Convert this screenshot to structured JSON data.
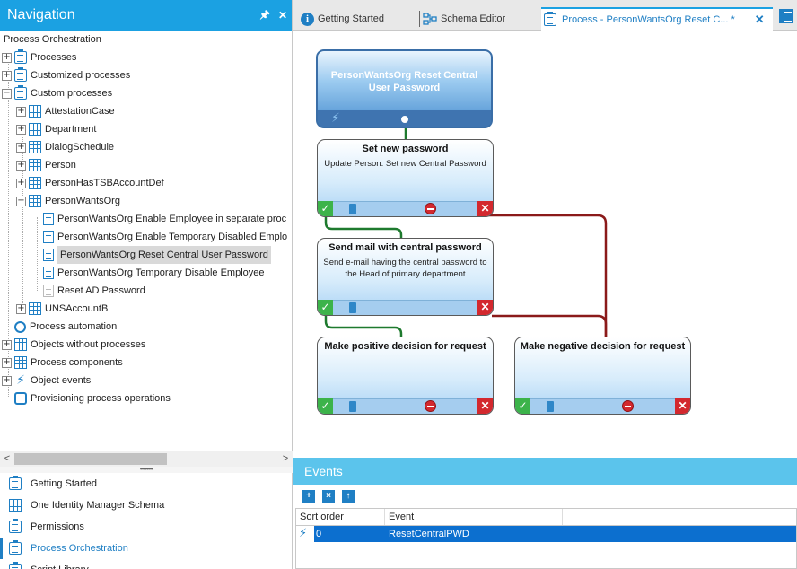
{
  "navigation": {
    "title": "Navigation",
    "pin_icon": "pin-icon",
    "close_icon": "close-icon",
    "tree": {
      "root": "Process Orchestration",
      "items": [
        {
          "label": "Processes",
          "icon": "clipboard-icon",
          "level": 0,
          "expander": "+"
        },
        {
          "label": "Customized processes",
          "icon": "clipboard-check-icon",
          "level": 0,
          "expander": "+"
        },
        {
          "label": "Custom processes",
          "icon": "user-process-icon",
          "level": 0,
          "expander": "−"
        },
        {
          "label": "AttestationCase",
          "icon": "table-icon",
          "level": 1,
          "expander": "+"
        },
        {
          "label": "Department",
          "icon": "table-icon",
          "level": 1,
          "expander": "+"
        },
        {
          "label": "DialogSchedule",
          "icon": "table-icon",
          "level": 1,
          "expander": "+"
        },
        {
          "label": "Person",
          "icon": "table-icon",
          "level": 1,
          "expander": "+"
        },
        {
          "label": "PersonHasTSBAccountDef",
          "icon": "table-icon",
          "level": 1,
          "expander": "+"
        },
        {
          "label": "PersonWantsOrg",
          "icon": "table-icon",
          "level": 1,
          "expander": "−"
        },
        {
          "label": "PersonWantsOrg Enable Employee in separate proc",
          "icon": "document-icon",
          "level": 2
        },
        {
          "label": "PersonWantsOrg Enable Temporary Disabled Emplo",
          "icon": "document-icon",
          "level": 2
        },
        {
          "label": "PersonWantsOrg Reset Central User Password",
          "icon": "document-icon",
          "level": 2,
          "selected": true
        },
        {
          "label": "PersonWantsOrg Temporary Disable Employee",
          "icon": "document-icon",
          "level": 2
        },
        {
          "label": "Reset AD Password",
          "icon": "document-disabled-icon",
          "level": 2
        },
        {
          "label": "UNSAccountB",
          "icon": "table-icon",
          "level": 1,
          "expander": "+"
        },
        {
          "label": "Process automation",
          "icon": "gear-icon",
          "level": 0
        },
        {
          "label": "Objects without processes",
          "icon": "table-icon",
          "level": 0,
          "expander": "+"
        },
        {
          "label": "Process components",
          "icon": "components-icon",
          "level": 0,
          "expander": "+"
        },
        {
          "label": "Object events",
          "icon": "lightning-icon",
          "level": 0,
          "expander": "+"
        },
        {
          "label": "Provisioning process operations",
          "icon": "sync-icon",
          "level": 0
        }
      ]
    },
    "bottom_items": [
      {
        "label": "Getting Started",
        "icon": "clipboard-check-icon"
      },
      {
        "label": "One Identity Manager Schema",
        "icon": "schema-icon"
      },
      {
        "label": "Permissions",
        "icon": "permissions-icon"
      },
      {
        "label": "Process Orchestration",
        "icon": "clipboard-icon",
        "active": true
      },
      {
        "label": "Script Library",
        "icon": "script-icon"
      }
    ],
    "scroll_left": "<",
    "scroll_right": ">",
    "splitter_grip": "••••••••"
  },
  "tabs": [
    {
      "label": "Getting Started",
      "icon": "info-icon"
    },
    {
      "label": "Schema Editor",
      "icon": "schema-icon"
    },
    {
      "label": "Process - PersonWantsOrg Reset C... *",
      "icon": "clipboard-icon",
      "active": true
    }
  ],
  "tab_close": "✕",
  "process": {
    "start_node": {
      "title": "PersonWantsOrg Reset Central User Password"
    },
    "nodes": [
      {
        "title": "Set new password",
        "description": "Update Person. Set new Central Password"
      },
      {
        "title": "Send mail with central password",
        "description": "Send e-mail having the central password to the Head of primary department"
      },
      {
        "title": "Make positive decision for request",
        "description": ""
      },
      {
        "title": "Make negative decision for request",
        "description": ""
      }
    ],
    "connector_colors": {
      "success": "#1e7a2e",
      "failure": "#8b1a1a"
    }
  },
  "events": {
    "title": "Events",
    "toolbar": [
      {
        "label": "+",
        "icon": "add-event-icon"
      },
      {
        "label": "×",
        "icon": "delete-event-icon"
      },
      {
        "label": "↑",
        "icon": "fire-event-icon"
      }
    ],
    "columns": [
      "Sort order",
      "Event"
    ],
    "rows": [
      {
        "sort_order": "0",
        "event": "ResetCentralPWD"
      }
    ]
  },
  "colors": {
    "accent": "#1ba1e2",
    "events_header": "#5bc4ec",
    "selected_row": "#0c6fcf"
  }
}
